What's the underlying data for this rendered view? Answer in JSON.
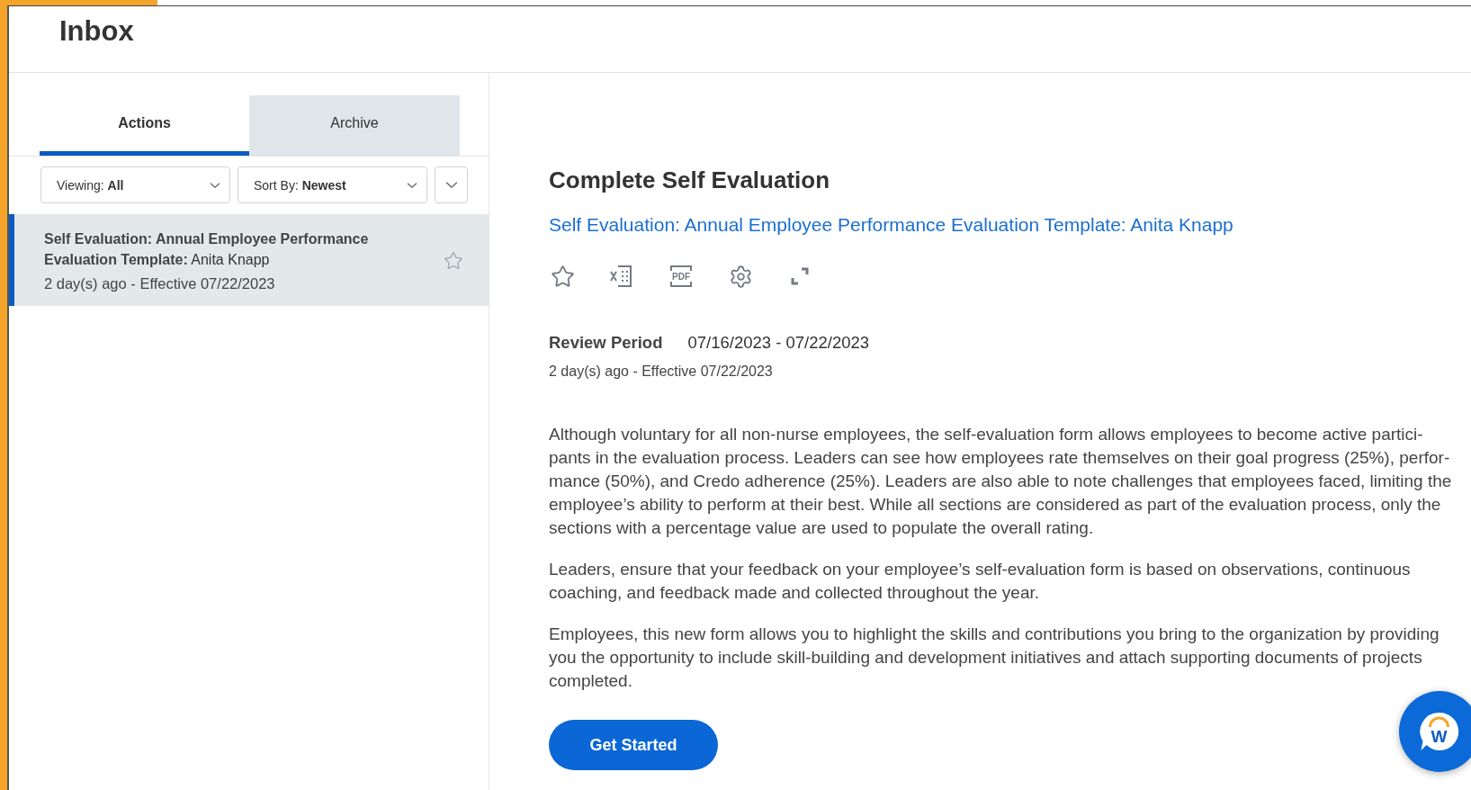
{
  "header": {
    "title": "Inbox"
  },
  "tabs": [
    {
      "label": "Actions",
      "selected": true
    },
    {
      "label": "Archive",
      "selected": false
    }
  ],
  "filters": [
    {
      "label": "Viewing:",
      "value": "All"
    },
    {
      "label": "Sort By:",
      "value": "Newest"
    }
  ],
  "inbox_items": [
    {
      "title": "**Self Evaluation: Annual Employee Performance Evaluation Template:** Anita Knapp",
      "meta": "2 day(s) ago - Effective 07/22/2023",
      "selected": true,
      "starred": false
    }
  ],
  "detail": {
    "heading": "Complete Self Evaluation",
    "link": "Self Evaluation: Annual Employee Performance Evaluation Template: Anita Knapp",
    "pdf_icon_label": "PDF",
    "review_label": "Review Period",
    "review_value": "07/16/2023 - 07/22/2023",
    "meta": "2 day(s) ago -  Effective 07/22/2023",
    "paragraphs": [
      "Although voluntary for all non-nurse employees, the self-evaluation form allows employees to become active partici-pants in the evaluation process. Leaders can see how employees rate themselves on their goal progress (25%), perfor-mance (50%), and Credo adherence (25%).  Leaders are also able to note challenges that employees faced, limiting the employee’s ability to perform at their best. While all sections are considered as part of the evaluation process, only the sections with a percentage value are used to populate the overall rating.",
      "Leaders, ensure that your feedback on your employee’s self-evaluation form is based on observations, continuous coaching, and feedback made and collected throughout the year.",
      "Employees, this new form allows you to highlight the skills and contributions you bring to the organization by providing you the opportunity to include skill-building and development initiatives and attach supporting documents of projects completed."
    ],
    "button": "Get Started"
  },
  "chat_button": {
    "label": "W"
  }
}
